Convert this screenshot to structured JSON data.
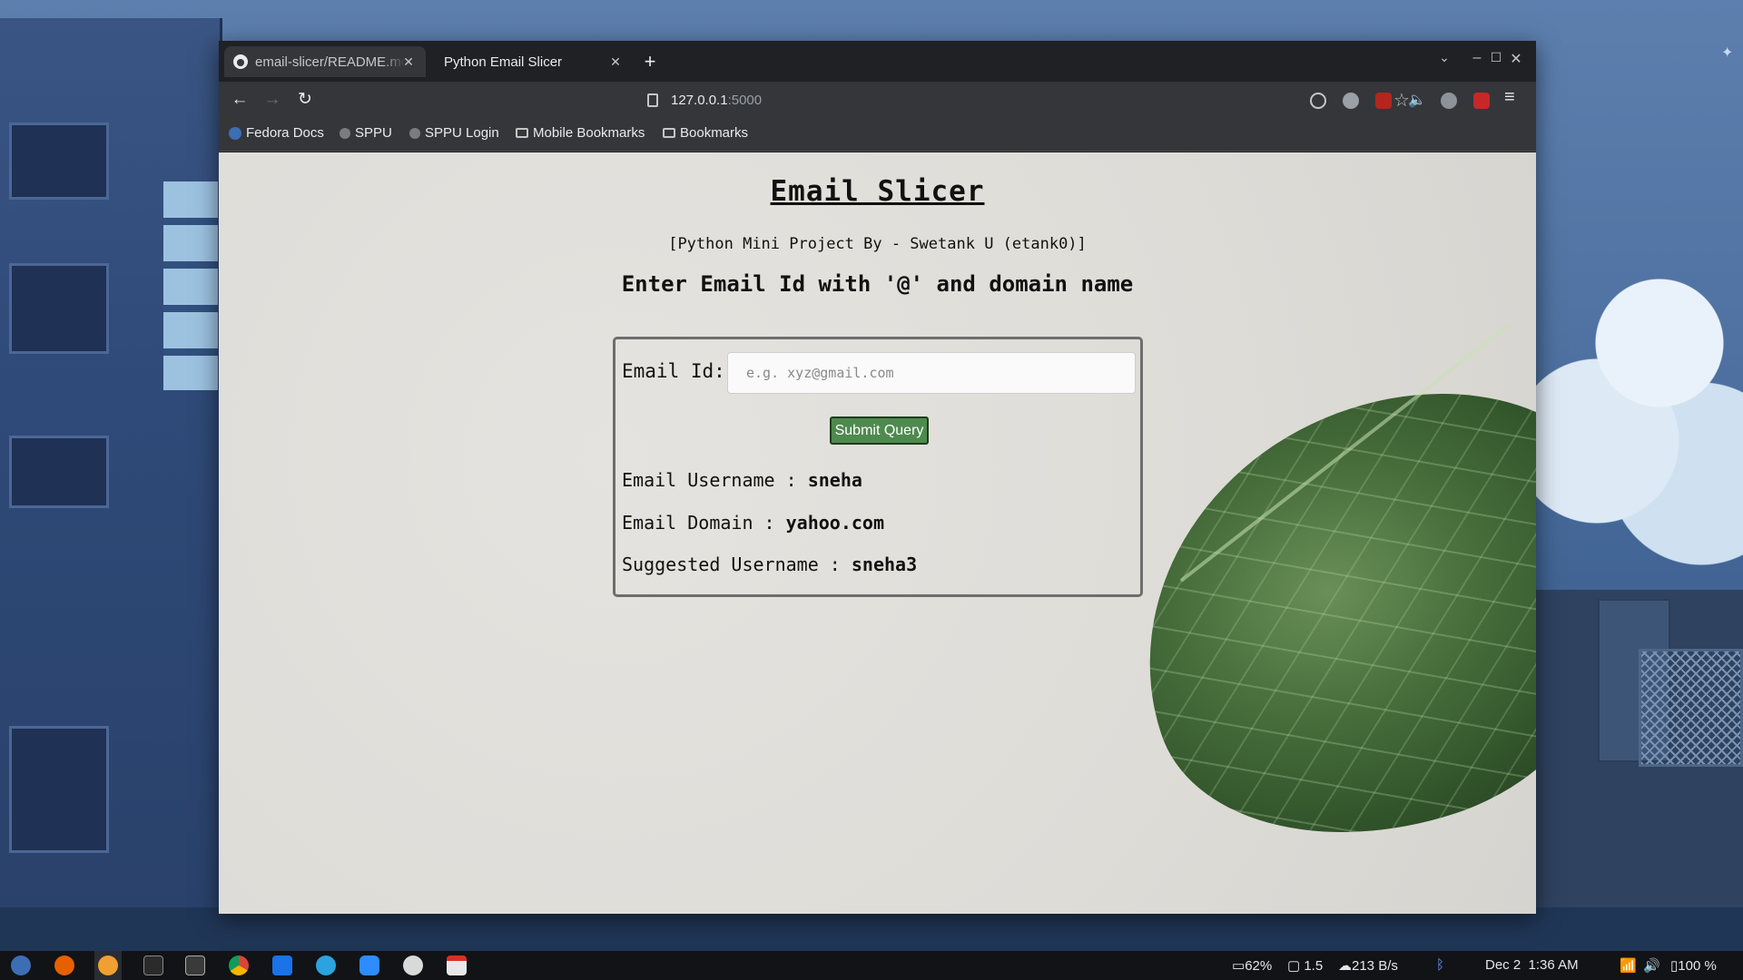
{
  "browser": {
    "tabs": [
      {
        "label": "email-slicer/README.md",
        "active": false
      },
      {
        "label": "Python Email Slicer",
        "active": true
      }
    ],
    "url_host": "127.0.0.1",
    "url_port": ":5000",
    "bookmarks": [
      {
        "label": "Fedora Docs",
        "icon": "fedora-icon"
      },
      {
        "label": "SPPU",
        "icon": "sppu-icon"
      },
      {
        "label": "SPPU Login",
        "icon": "sppu-icon"
      },
      {
        "label": "Mobile Bookmarks",
        "icon": "folder-icon"
      },
      {
        "label": "Bookmarks",
        "icon": "folder-icon"
      }
    ]
  },
  "page": {
    "title": "Email Slicer",
    "subtitle": "[Python Mini Project By - Swetank U (etank0)]",
    "prompt": "Enter Email Id with '@' and domain name",
    "form": {
      "email_label": "Email Id:",
      "email_placeholder": "e.g. xyz@gmail.com",
      "email_value": "",
      "submit_label": "Submit Query"
    },
    "results": {
      "username_label": "Email Username :",
      "username_value": "sneha",
      "domain_label": "Email Domain :",
      "domain_value": "yahoo.com",
      "suggested_label": "Suggested Username :",
      "suggested_value": "sneha3"
    }
  },
  "taskbar": {
    "battery_saver": "62%",
    "load": "1.5",
    "network": "213 B/s",
    "date": "Dec 2",
    "time": "1:36 AM",
    "battery": "100 %"
  },
  "colors": {
    "submit_bg": "#4e8a4e",
    "page_bg": "#dedcd7",
    "browser_chrome": "#35363a"
  }
}
